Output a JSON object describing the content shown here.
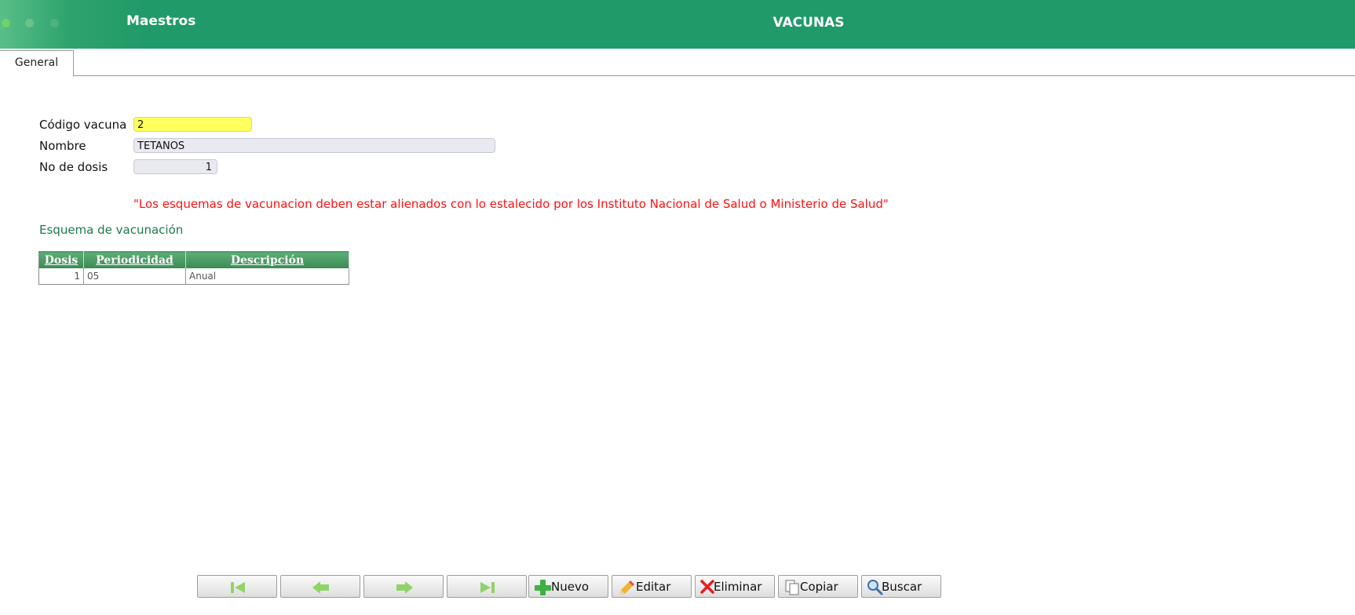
{
  "header": {
    "section": "Maestros",
    "title": "VACUNAS"
  },
  "tabs": [
    {
      "label": "General"
    }
  ],
  "form": {
    "code_label": "Código vacuna",
    "code_value": "2",
    "name_label": "Nombre",
    "name_value": "TETANOS",
    "doses_label": "No de dosis",
    "doses_value": "1"
  },
  "warning": "\"Los esquemas de vacunacion deben estar alienados con lo estalecido por los Instituto Nacional de Salud o Ministerio de Salud\"",
  "scheme": {
    "title": "Esquema de vacunación",
    "columns": [
      "Dosis",
      "Periodicidad",
      "Descripción"
    ],
    "rows": [
      {
        "dosis": "1",
        "periodicidad": "05",
        "descripcion": "Anual"
      }
    ]
  },
  "toolbar": {
    "first": "",
    "prev": "",
    "next": "",
    "last": "",
    "nuevo": "Nuevo",
    "editar": "Editar",
    "eliminar": "Eliminar",
    "copiar": "Copiar",
    "buscar": "Buscar"
  },
  "colors": {
    "header": "#1f9a68",
    "required_field": "#ffff5e",
    "warning": "#ff1111",
    "grid_header": "#4a9b63"
  }
}
